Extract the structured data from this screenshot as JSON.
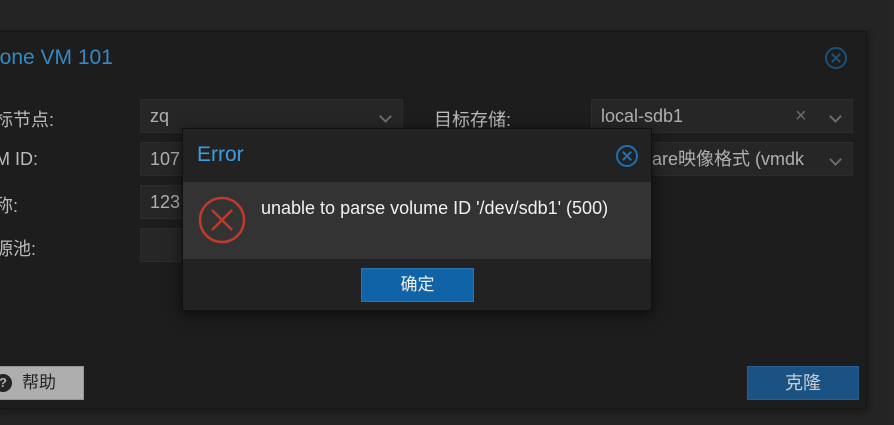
{
  "clone_window": {
    "title": "lone VM 101",
    "fields": {
      "target_node_label": "标节点:",
      "target_node_value": "zq",
      "target_storage_label": "目标存储:",
      "target_storage_value": "local-sdb1",
      "vm_id_label": "M ID:",
      "vm_id_value": "107",
      "format_value": "are映像格式 (vmdk",
      "name_label": "称:",
      "name_value": "123",
      "pool_label": "源池:"
    },
    "help_label": "帮助",
    "clone_label": "克隆"
  },
  "error_dialog": {
    "title": "Error",
    "message": "unable to parse volume ID '/dev/sdb1' (500)",
    "ok_label": "确定"
  },
  "colors": {
    "accent_title": "#3c9ce0",
    "error_icon": "#c0392b",
    "primary_button": "#0f63a6"
  },
  "icons": [
    "close-icon",
    "chevron-down-icon",
    "clear-icon",
    "help-icon",
    "error-icon"
  ]
}
